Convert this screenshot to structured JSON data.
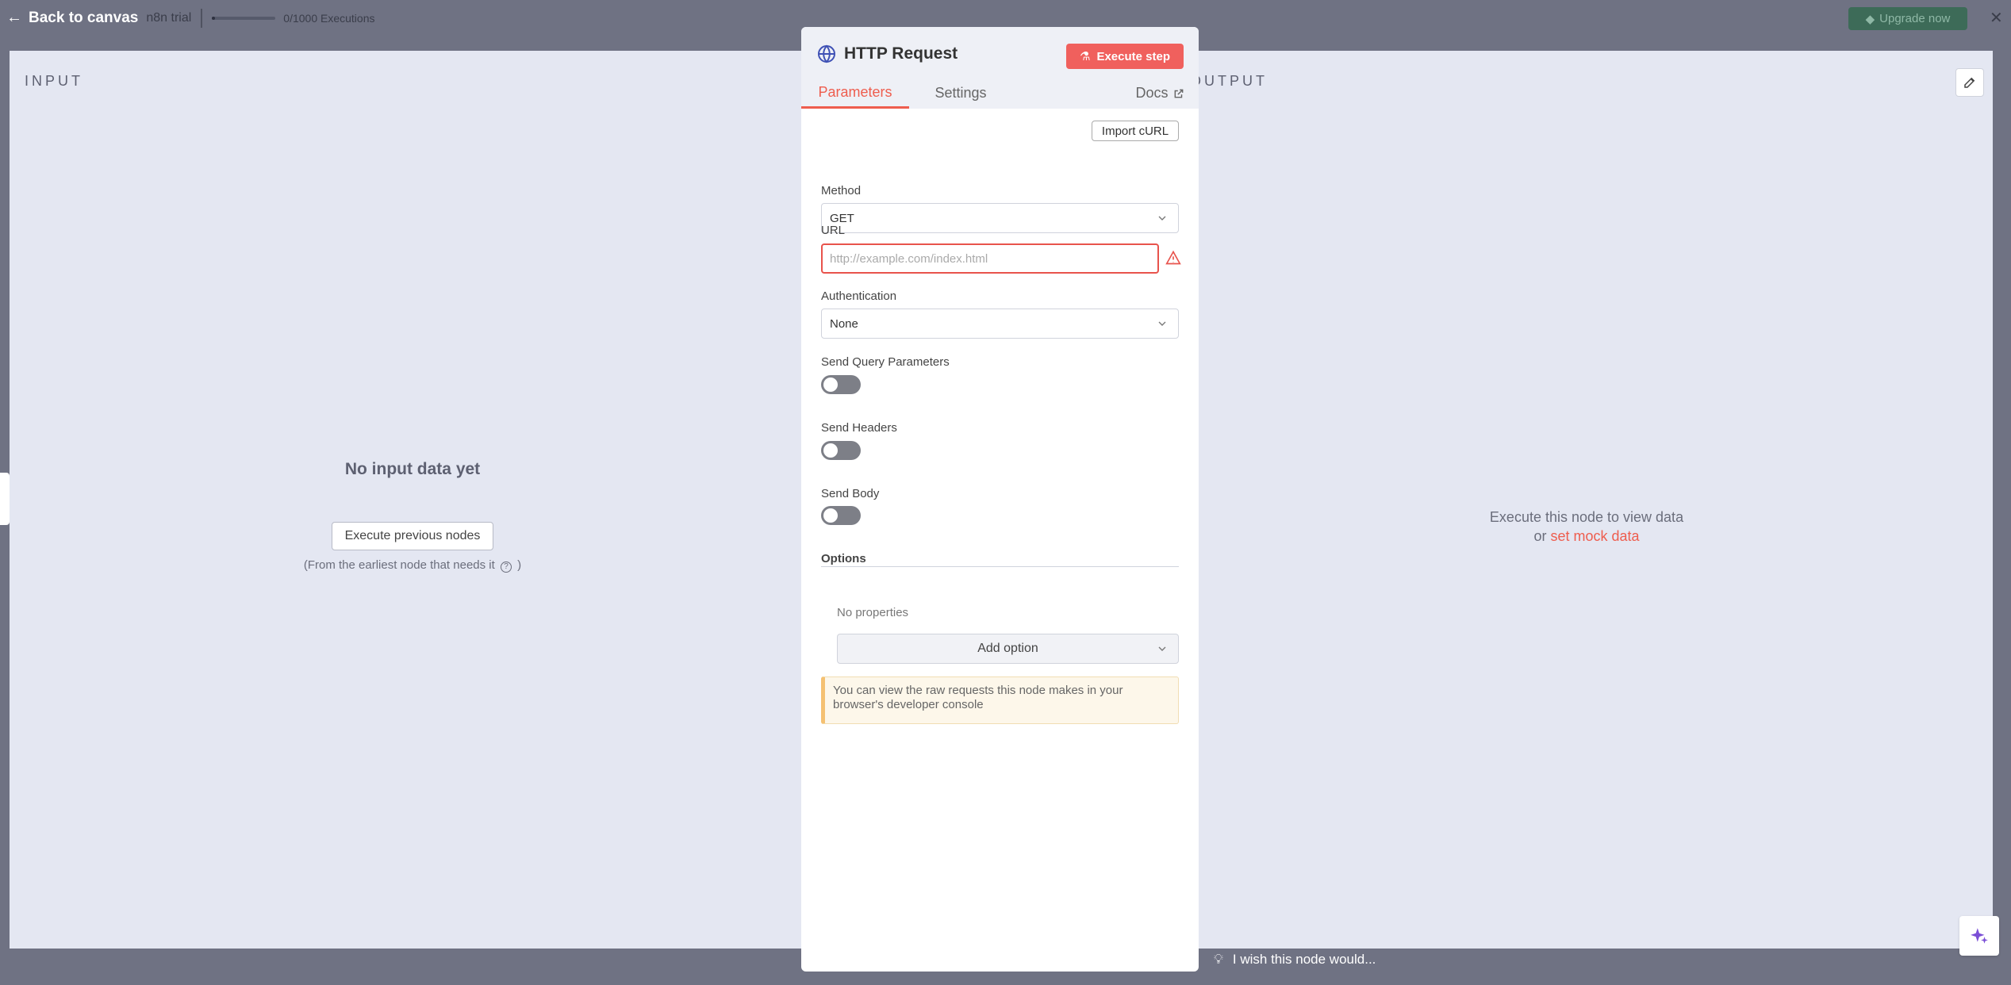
{
  "topbar": {
    "back_label": "Back to canvas",
    "trial_label": "n8n trial",
    "executions_label": "0/1000 Executions",
    "executions_used_fraction": 0,
    "upgrade_label": "Upgrade now"
  },
  "input_panel": {
    "title": "INPUT",
    "empty_title": "No input data yet",
    "execute_previous_label": "Execute previous nodes",
    "note_text": "(From the earliest node that needs it",
    "note_close": ")"
  },
  "output_panel": {
    "title": "OUTPUT",
    "message": "Execute this node to view data",
    "or_label": "or",
    "mock_link": "set mock data"
  },
  "node": {
    "title": "HTTP Request",
    "execute_label": "Execute step",
    "tabs": [
      {
        "label": "Parameters",
        "active": true
      },
      {
        "label": "Settings",
        "active": false
      },
      {
        "label": "Docs",
        "active": false
      }
    ],
    "import_curl_label": "Import cURL",
    "method": {
      "label": "Method",
      "value": "GET"
    },
    "url": {
      "label": "URL",
      "placeholder": "http://example.com/index.html",
      "value": ""
    },
    "authentication": {
      "label": "Authentication",
      "value": "None"
    },
    "send_query": {
      "label": "Send Query Parameters",
      "enabled": false
    },
    "send_headers": {
      "label": "Send Headers",
      "enabled": false
    },
    "send_body": {
      "label": "Send Body",
      "enabled": false
    },
    "options": {
      "title": "Options",
      "empty_label": "No properties",
      "add_option_label": "Add option"
    },
    "notice": "You can view the raw requests this node makes in your browser's developer console"
  },
  "footer": {
    "wish_label": "I wish this node would..."
  },
  "colors": {
    "accent": "#ee5d4e",
    "execute_button": "#f0605d",
    "upgrade_button": "#3d6b58",
    "overlay_bg": "#e4e7f2"
  }
}
